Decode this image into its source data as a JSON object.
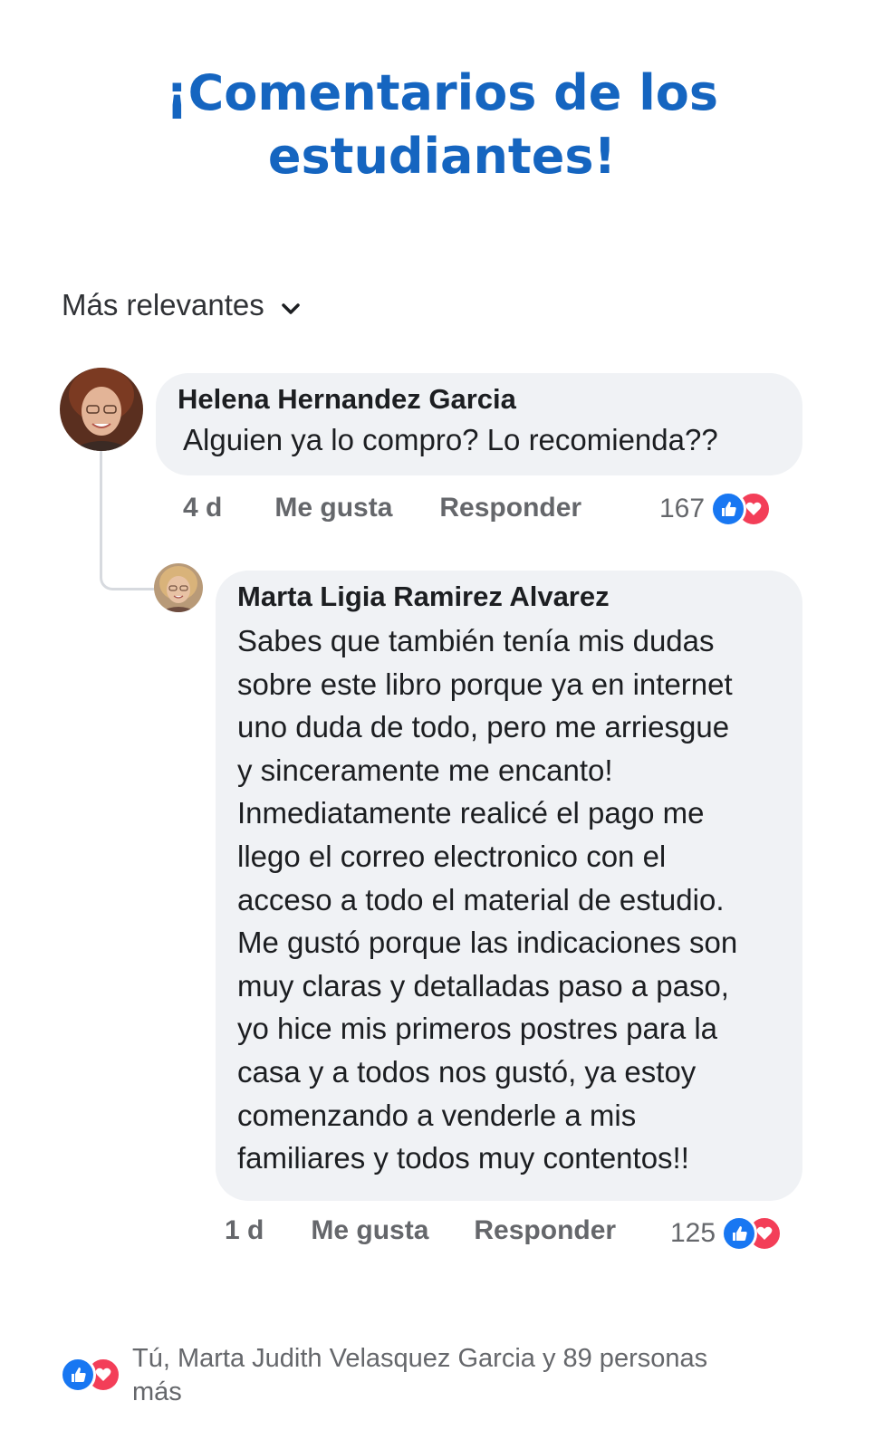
{
  "headline": {
    "line1": "¡Comentarios de los",
    "line2": "estudiantes!"
  },
  "sort": {
    "label": "Más relevantes",
    "icon": "chevron-down-icon"
  },
  "comments": [
    {
      "author": "Helena Hernandez Garcia",
      "text": "Alguien ya lo compro? Lo recomienda??",
      "time": "4 d",
      "like_label": "Me gusta",
      "reply_label": "Responder",
      "reaction_count": "167"
    },
    {
      "author": "Marta Ligia Ramirez Alvarez",
      "text_lines": [
        "Sabes que también tenía mis dudas",
        "sobre este libro porque ya en internet",
        "uno duda de todo, pero me arriesgue",
        "y sinceramente me encanto!",
        "Inmediatamente realicé el pago me",
        "llego el correo electronico con el",
        "acceso a todo el material de estudio.",
        "Me gustó porque las indicaciones son",
        "muy claras y detalladas paso a paso,",
        "yo hice mis primeros postres para la",
        "casa y a todos nos gustó, ya estoy",
        "comenzando a venderle a mis",
        "familiares y todos muy contentos!!"
      ],
      "time": "1 d",
      "like_label": "Me gusta",
      "reply_label": "Responder",
      "reaction_count": "125"
    }
  ],
  "footer": {
    "line1": "Tú, Marta Judith Velasquez Garcia y 89 personas",
    "line2": "más"
  },
  "colors": {
    "headline": "#1565c0",
    "bubble": "#f0f2f5",
    "like": "#1877f2",
    "love": "#f33e58",
    "meta": "#65676b"
  }
}
